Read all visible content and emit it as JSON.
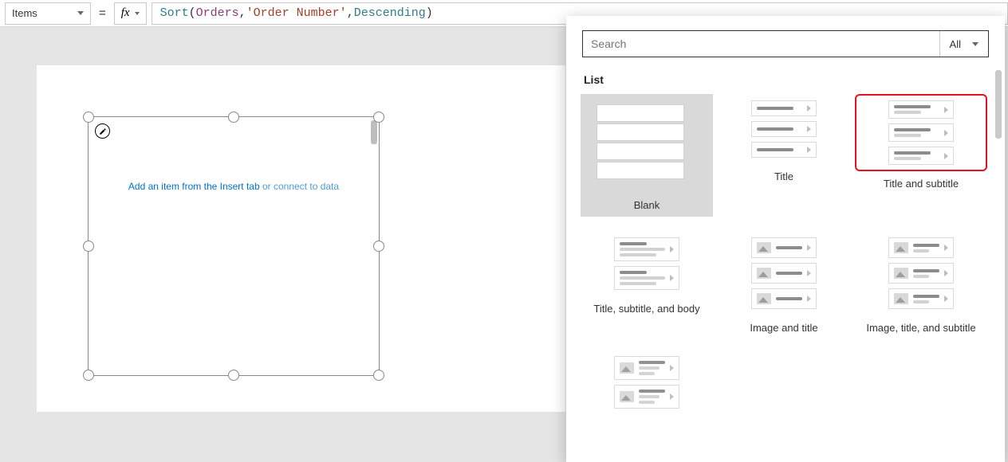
{
  "formula_bar": {
    "property": "Items",
    "equals": "=",
    "fx_label": "fx",
    "tokens": {
      "fn": "Sort",
      "open": "( ",
      "id": "Orders",
      "sep1": ", ",
      "str": "'Order Number'",
      "sep2": ", ",
      "kw": "Descending",
      "close": " )"
    }
  },
  "canvas": {
    "hint_left": "Add an item from the Insert tab ",
    "hint_right": "or connect to data"
  },
  "panel": {
    "search_placeholder": "Search",
    "filter_label": "All",
    "section": "List",
    "options": {
      "blank": "Blank",
      "title": "Title",
      "title_subtitle": "Title and subtitle",
      "title_subtitle_body": "Title, subtitle, and body",
      "image_title": "Image and title",
      "image_title_subtitle": "Image, title, and subtitle"
    }
  }
}
